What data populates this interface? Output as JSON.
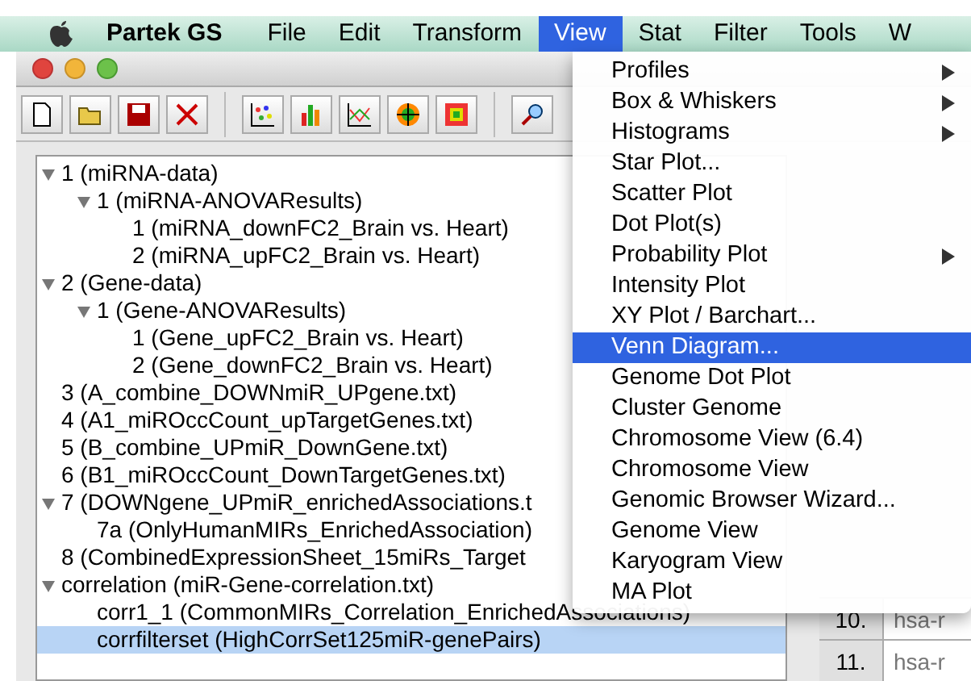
{
  "menubar": {
    "app": "Partek GS",
    "items": [
      {
        "label": "File",
        "selected": false
      },
      {
        "label": "Edit",
        "selected": false
      },
      {
        "label": "Transform",
        "selected": false
      },
      {
        "label": "View",
        "selected": true
      },
      {
        "label": "Stat",
        "selected": false
      },
      {
        "label": "Filter",
        "selected": false
      },
      {
        "label": "Tools",
        "selected": false
      },
      {
        "label": "W",
        "selected": false
      }
    ]
  },
  "view_menu": [
    {
      "label": "Profiles",
      "submenu": true,
      "selected": false
    },
    {
      "label": "Box & Whiskers",
      "submenu": true,
      "selected": false
    },
    {
      "label": "Histograms",
      "submenu": true,
      "selected": false
    },
    {
      "label": "Star Plot...",
      "submenu": false,
      "selected": false
    },
    {
      "label": "Scatter Plot",
      "submenu": false,
      "selected": false
    },
    {
      "label": "Dot Plot(s)",
      "submenu": false,
      "selected": false
    },
    {
      "label": "Probability Plot",
      "submenu": true,
      "selected": false
    },
    {
      "label": "Intensity Plot",
      "submenu": false,
      "selected": false
    },
    {
      "label": "XY Plot / Barchart...",
      "submenu": false,
      "selected": false
    },
    {
      "label": "Venn Diagram...",
      "submenu": false,
      "selected": true
    },
    {
      "label": "Genome Dot Plot",
      "submenu": false,
      "selected": false
    },
    {
      "label": "Cluster Genome",
      "submenu": false,
      "selected": false
    },
    {
      "label": "Chromosome View (6.4)",
      "submenu": false,
      "selected": false
    },
    {
      "label": "Chromosome View",
      "submenu": false,
      "selected": false
    },
    {
      "label": "Genomic Browser Wizard...",
      "submenu": false,
      "selected": false
    },
    {
      "label": "Genome View",
      "submenu": false,
      "selected": false
    },
    {
      "label": "Karyogram View",
      "submenu": false,
      "selected": false
    },
    {
      "label": "MA Plot",
      "submenu": false,
      "selected": false
    }
  ],
  "tree": [
    {
      "label": "1 (miRNA-data)",
      "expanded": true,
      "selected": false,
      "children": [
        {
          "label": "1 (miRNA-ANOVAResults)",
          "expanded": true,
          "selected": false,
          "children": [
            {
              "label": "1 (miRNA_downFC2_Brain vs. Heart)",
              "selected": false
            },
            {
              "label": "2 (miRNA_upFC2_Brain vs. Heart)",
              "selected": false
            }
          ]
        }
      ]
    },
    {
      "label": "2 (Gene-data)",
      "expanded": true,
      "selected": false,
      "children": [
        {
          "label": "1 (Gene-ANOVAResults)",
          "expanded": true,
          "selected": false,
          "children": [
            {
              "label": "1 (Gene_upFC2_Brain vs. Heart)",
              "selected": false
            },
            {
              "label": "2 (Gene_downFC2_Brain vs. Heart)",
              "selected": false
            }
          ]
        }
      ]
    },
    {
      "label": "3 (A_combine_DOWNmiR_UPgene.txt)",
      "selected": false
    },
    {
      "label": "4 (A1_miROccCount_upTargetGenes.txt)",
      "selected": false
    },
    {
      "label": "5 (B_combine_UPmiR_DownGene.txt)",
      "selected": false
    },
    {
      "label": "6 (B1_miROccCount_DownTargetGenes.txt)",
      "selected": false
    },
    {
      "label": "7 (DOWNgene_UPmiR_enrichedAssociations.t",
      "expanded": true,
      "selected": false,
      "children": [
        {
          "label": "7a (OnlyHumanMIRs_EnrichedAssociation)",
          "selected": false
        }
      ]
    },
    {
      "label": "8 (CombinedExpressionSheet_15miRs_Target",
      "selected": false
    },
    {
      "label": "correlation (miR-Gene-correlation.txt)",
      "expanded": true,
      "selected": false,
      "children": [
        {
          "label": "corr1_1 (CommonMIRs_Correlation_EnrichedAssociations)",
          "selected": false
        },
        {
          "label": "corrfilterset (HighCorrSet125miR-genePairs)",
          "selected": true
        }
      ]
    }
  ],
  "table_rows": [
    {
      "index": "10.",
      "cell": "hsa-r"
    },
    {
      "index": "11.",
      "cell": "hsa-r"
    }
  ]
}
